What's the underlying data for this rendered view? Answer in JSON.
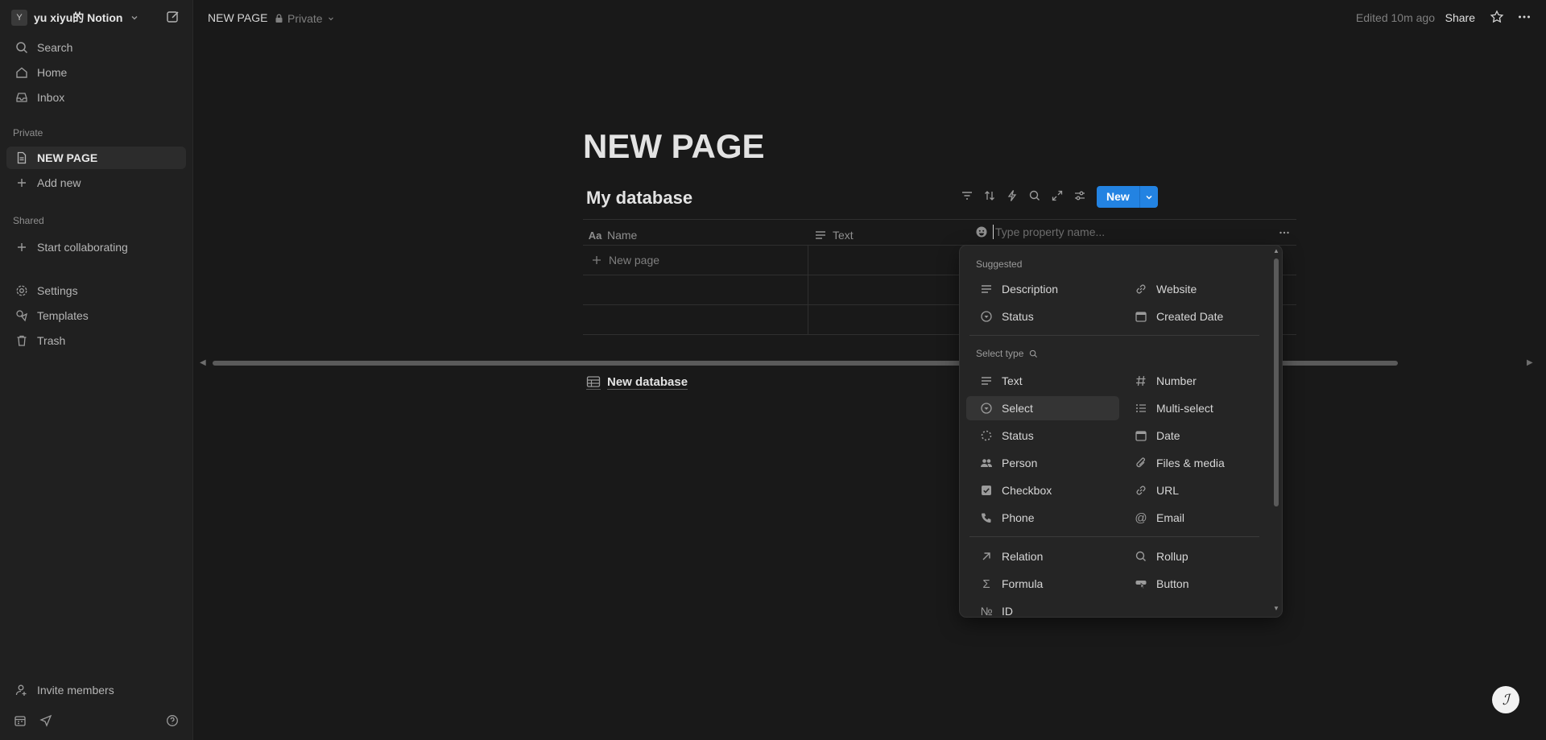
{
  "workspace": {
    "avatar_letter": "Y",
    "name": "yu xiyu的 Notion"
  },
  "sidebar": {
    "top_items": [
      {
        "label": "Search",
        "icon": "search-icon"
      },
      {
        "label": "Home",
        "icon": "home-icon"
      },
      {
        "label": "Inbox",
        "icon": "inbox-icon"
      }
    ],
    "private_label": "Private",
    "private_items": [
      {
        "label": "NEW PAGE",
        "icon": "page-icon"
      },
      {
        "label": "Add new",
        "icon": "plus-icon"
      }
    ],
    "shared_label": "Shared",
    "shared_items": [
      {
        "label": "Start collaborating",
        "icon": "plus-icon"
      }
    ],
    "bottom_items": [
      {
        "label": "Settings",
        "icon": "gear-icon"
      },
      {
        "label": "Templates",
        "icon": "templates-icon"
      },
      {
        "label": "Trash",
        "icon": "trash-icon"
      }
    ],
    "invite_label": "Invite members"
  },
  "topbar": {
    "breadcrumb": "NEW PAGE",
    "privacy": "Private",
    "edited": "Edited 10m ago",
    "share_label": "Share"
  },
  "page": {
    "title": "NEW PAGE"
  },
  "database": {
    "title": "My database",
    "new_button": "New",
    "columns": [
      {
        "label": "Name",
        "icon": "text-aa-icon"
      },
      {
        "label": "Text",
        "icon": "lines-icon"
      }
    ],
    "new_property_placeholder": "Type property name...",
    "new_page_label": "New page"
  },
  "new_database_label": "New database",
  "property_menu": {
    "suggested_label": "Suggested",
    "suggested": [
      {
        "label": "Description",
        "icon": "lines-icon"
      },
      {
        "label": "Website",
        "icon": "link-icon"
      },
      {
        "label": "Status",
        "icon": "status-icon"
      },
      {
        "label": "Created Date",
        "icon": "calendar-icon"
      }
    ],
    "select_type_label": "Select type",
    "types": [
      {
        "label": "Text",
        "icon": "lines-icon"
      },
      {
        "label": "Number",
        "icon": "hash-icon"
      },
      {
        "label": "Select",
        "icon": "select-icon"
      },
      {
        "label": "Multi-select",
        "icon": "list-icon"
      },
      {
        "label": "Status",
        "icon": "status-dashed-icon"
      },
      {
        "label": "Date",
        "icon": "calendar-icon"
      },
      {
        "label": "Person",
        "icon": "people-icon"
      },
      {
        "label": "Files & media",
        "icon": "paperclip-icon"
      },
      {
        "label": "Checkbox",
        "icon": "checkbox-icon"
      },
      {
        "label": "URL",
        "icon": "link-icon"
      },
      {
        "label": "Phone",
        "icon": "phone-icon"
      },
      {
        "label": "Email",
        "icon": "at-icon"
      }
    ],
    "advanced": [
      {
        "label": "Relation",
        "icon": "arrow-up-right-icon"
      },
      {
        "label": "Rollup",
        "icon": "search-icon"
      },
      {
        "label": "Formula",
        "icon": "sigma-icon"
      },
      {
        "label": "Button",
        "icon": "button-icon"
      },
      {
        "label": "ID",
        "icon": "number-sign-icon",
        "glyph": "№"
      }
    ],
    "highlighted": "Select"
  }
}
